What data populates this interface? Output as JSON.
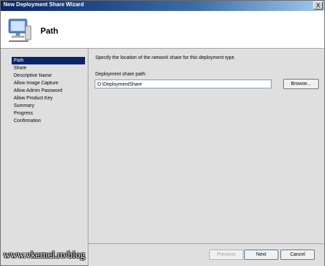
{
  "window": {
    "title": "New Deployment Share Wizard",
    "close_label": "X"
  },
  "header": {
    "page_title": "Path",
    "icon": "computer-icon"
  },
  "sidebar": {
    "items": [
      {
        "label": "Path",
        "selected": true
      },
      {
        "label": "Share",
        "selected": false
      },
      {
        "label": "Descriptive Name",
        "selected": false
      },
      {
        "label": "Allow Image Capture",
        "selected": false
      },
      {
        "label": "Allow Admin Password",
        "selected": false
      },
      {
        "label": "Allow Product Key",
        "selected": false
      },
      {
        "label": "Summary",
        "selected": false
      },
      {
        "label": "Progress",
        "selected": false
      },
      {
        "label": "Confirmation",
        "selected": false
      }
    ]
  },
  "main": {
    "instruction": "Specify the location of the network share for this deployment type.",
    "path_label": "Deployment share path:",
    "path_value": "D:\\DeploymentShare",
    "browse_label": "Browse..."
  },
  "footer": {
    "previous_label": "Previous",
    "next_label": "Next",
    "cancel_label": "Cancel"
  },
  "watermark": "www.vkernel.ro/blog"
}
